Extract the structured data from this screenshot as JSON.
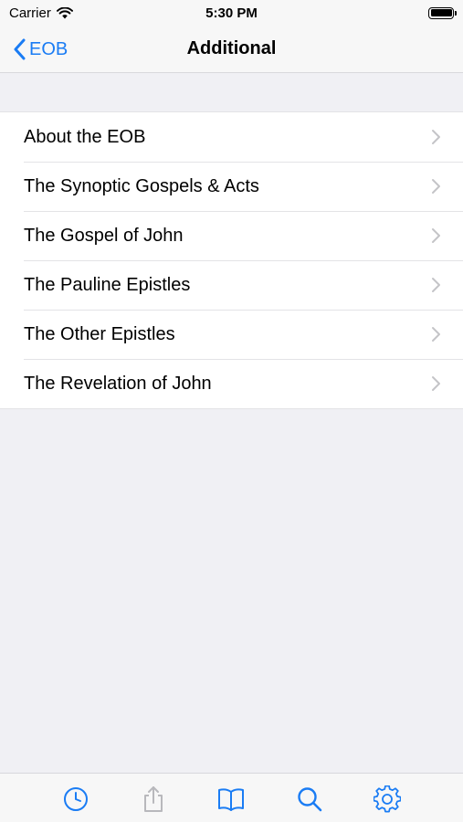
{
  "status_bar": {
    "carrier": "Carrier",
    "time": "5:30 PM"
  },
  "nav": {
    "back_label": "EOB",
    "title": "Additional"
  },
  "list": {
    "items": [
      {
        "label": "About the EOB"
      },
      {
        "label": "The Synoptic Gospels & Acts"
      },
      {
        "label": "The Gospel of John"
      },
      {
        "label": "The Pauline Epistles"
      },
      {
        "label": "The Other Epistles"
      },
      {
        "label": "The Revelation of John"
      }
    ]
  },
  "tab_bar": {
    "icons": [
      "clock-icon",
      "share-icon",
      "book-icon",
      "search-icon",
      "gear-icon"
    ],
    "active_color": "#1a7cf4",
    "disabled_color": "#b8b8bc"
  },
  "colors": {
    "accent": "#1a7cf4",
    "background": "#f0f0f4",
    "chevron": "#c4c4c7"
  }
}
